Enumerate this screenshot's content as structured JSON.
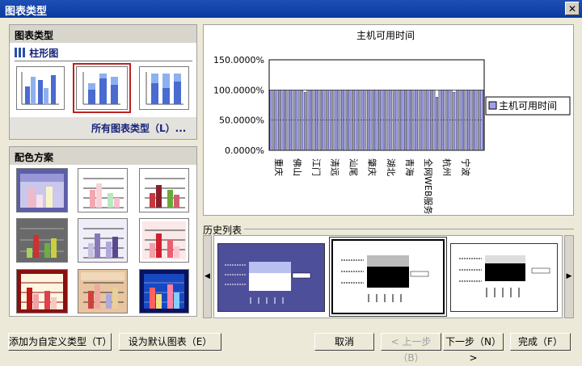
{
  "window": {
    "title": "图表类型",
    "close_icon": "close-icon"
  },
  "chart_type_panel": {
    "header": "图表类型",
    "current_type": "柱形图",
    "all_types_link": "所有图表类型（L）..."
  },
  "color_panel": {
    "header": "配色方案"
  },
  "history": {
    "label": "历史列表"
  },
  "buttons": {
    "add_custom": "添加为自定义类型（T）",
    "set_default": "设为默认图表（E）",
    "cancel": "取消",
    "back": "< 上一步（B）",
    "next": "下一步（N）>",
    "finish": "完成（F）"
  },
  "preview": {
    "legend_label": "主机可用时间"
  },
  "chart_data": {
    "type": "bar",
    "title": "主机可用时间",
    "ylim": [
      0,
      150
    ],
    "y_ticks": [
      "0.0000%",
      "50.0000%",
      "100.0000%",
      "150.0000%"
    ],
    "categories": [
      "重庆",
      "佛山",
      "江门",
      "清远",
      "汕尾",
      "肇庆",
      "湖北",
      "青海",
      "全网WEB服务器",
      "杭州",
      "宁波"
    ],
    "values": [
      100,
      100,
      100,
      100,
      100,
      100,
      100,
      100,
      100,
      100,
      100,
      99,
      96,
      100,
      100,
      100,
      100,
      100,
      100,
      100,
      100,
      100,
      100,
      100,
      100,
      100,
      100,
      100,
      100,
      100,
      100,
      100,
      100,
      100,
      100,
      100,
      100,
      100,
      100,
      100,
      100,
      100,
      100,
      100,
      100,
      100,
      100,
      100,
      100,
      100,
      100,
      100,
      100,
      100,
      100,
      100,
      100,
      100,
      88,
      100,
      100,
      100,
      100,
      100,
      96,
      100,
      100,
      100,
      100,
      100,
      100,
      100,
      100,
      100,
      100
    ],
    "series": [
      {
        "name": "主机可用时间"
      }
    ],
    "legend": "right",
    "grid": true
  }
}
